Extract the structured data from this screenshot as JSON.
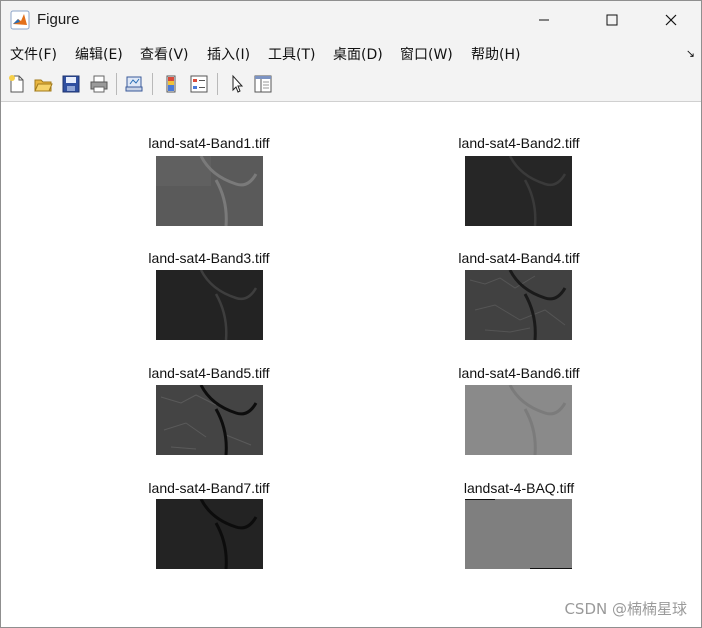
{
  "window": {
    "title": "Figure",
    "controls": [
      "minimize",
      "maximize",
      "close"
    ]
  },
  "menubar": {
    "items": [
      {
        "label": "文件(F)"
      },
      {
        "label": "编辑(E)"
      },
      {
        "label": "查看(V)"
      },
      {
        "label": "插入(I)"
      },
      {
        "label": "工具(T)"
      },
      {
        "label": "桌面(D)"
      },
      {
        "label": "窗口(W)"
      },
      {
        "label": "帮助(H)"
      }
    ],
    "overflow_arrow": "↘"
  },
  "toolbar": {
    "icons": [
      "new-figure-icon",
      "open-file-icon",
      "save-icon",
      "print-icon",
      "link-plot-icon",
      "colorbar-icon",
      "legend-icon",
      "pointer-icon",
      "property-editor-icon"
    ]
  },
  "figure": {
    "subplots": [
      {
        "title": "land-sat4-Band1.tiff",
        "tone": "#5a5a5a"
      },
      {
        "title": "land-sat4-Band2.tiff",
        "tone": "#2a2a2a"
      },
      {
        "title": "land-sat4-Band3.tiff",
        "tone": "#262626"
      },
      {
        "title": "land-sat4-Band4.tiff",
        "tone": "#3a3a3a"
      },
      {
        "title": "land-sat4-Band5.tiff",
        "tone": "#444444"
      },
      {
        "title": "land-sat4-Band6.tiff",
        "tone": "#8a8a8a"
      },
      {
        "title": "land-sat4-Band7.tiff",
        "tone": "#242424"
      },
      {
        "title": "landsat-4-BAQ.tiff",
        "tone": "#7f7f7f"
      }
    ]
  },
  "watermark": "CSDN @楠楠星球"
}
